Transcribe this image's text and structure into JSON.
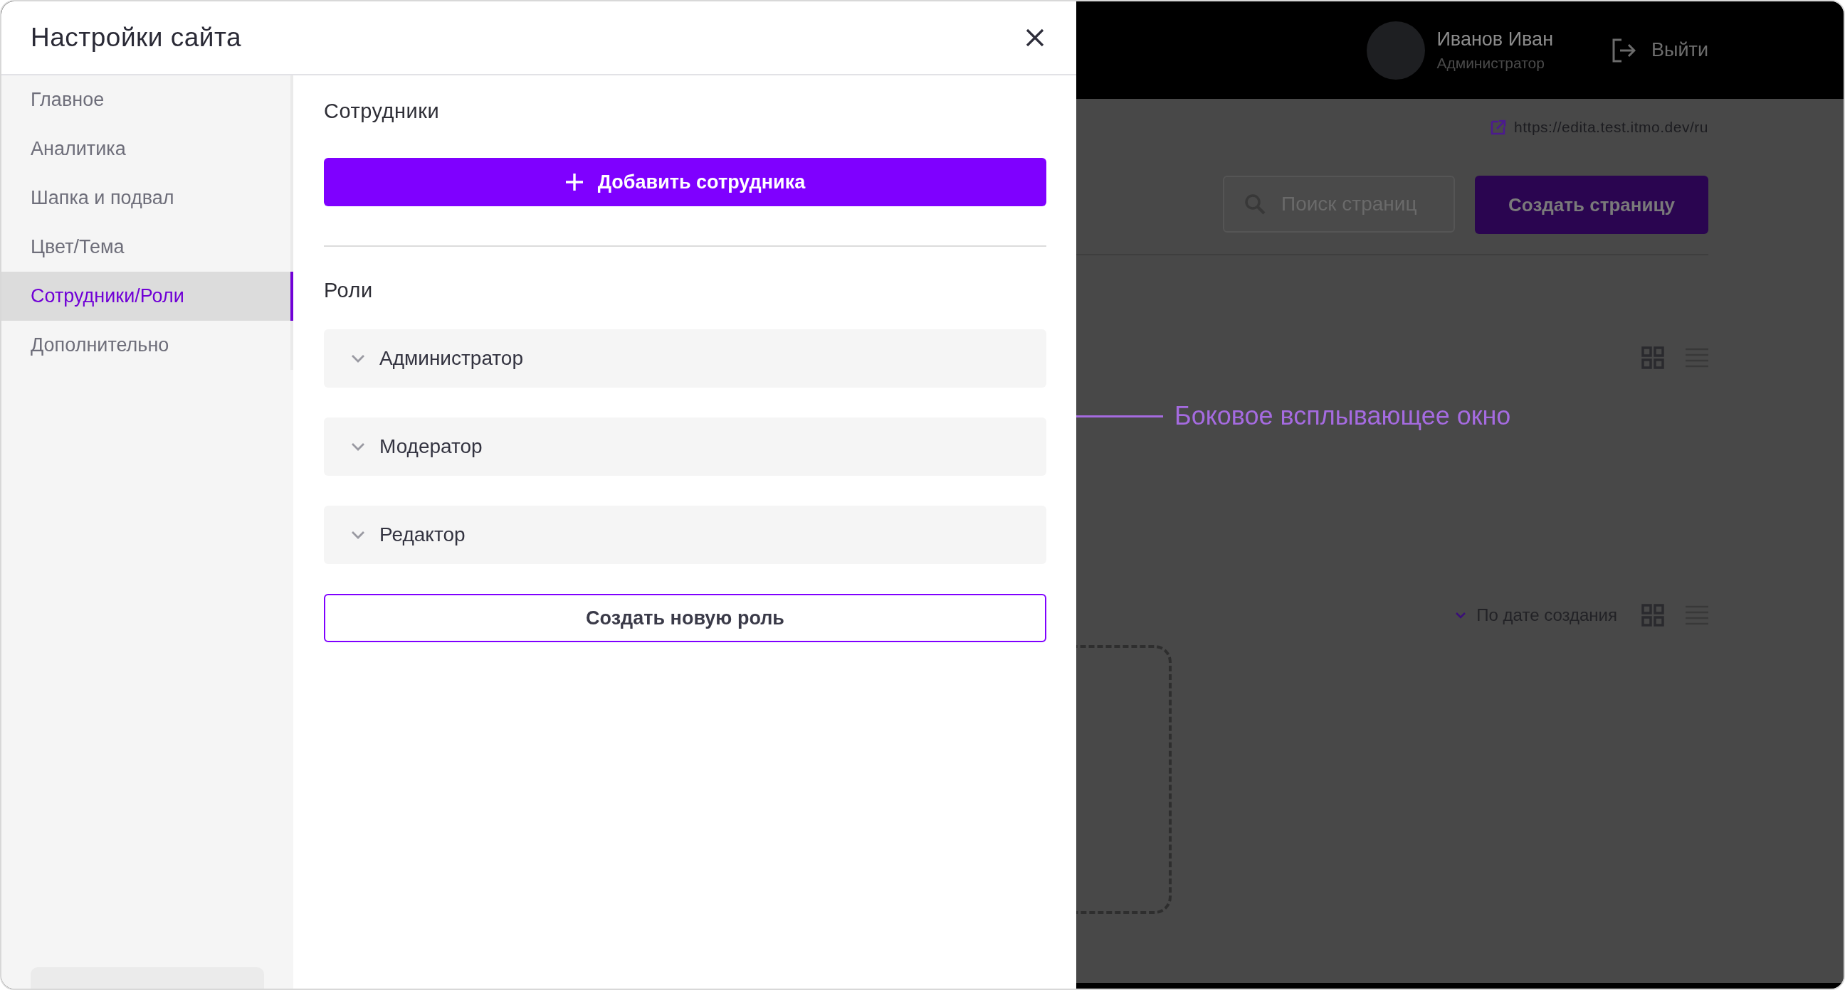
{
  "background_page": {
    "user": {
      "name": "Иванов Иван",
      "role": "Администратор"
    },
    "logout": "Выйти",
    "site_url": "https://edita.test.itmo.dev/ru",
    "search": {
      "placeholder": "Поиск страниц"
    },
    "create_button": "Создать страницу",
    "sort": {
      "label": "По дате создания"
    }
  },
  "annotation": {
    "text": "Боковое всплывающее окно"
  },
  "drawer": {
    "title": "Настройки сайта",
    "sidebar": {
      "items": [
        {
          "label": "Главное",
          "selected": false
        },
        {
          "label": "Аналитика",
          "selected": false
        },
        {
          "label": "Шапка и подвал",
          "selected": false
        },
        {
          "label": "Цвет/Тема",
          "selected": false
        },
        {
          "label": "Сотрудники/Роли",
          "selected": true
        },
        {
          "label": "Дополнительно",
          "selected": false
        }
      ]
    },
    "staff": {
      "title": "Сотрудники",
      "add_button": "Добавить сотрудника"
    },
    "roles": {
      "title": "Роли",
      "items": [
        {
          "label": "Администратор"
        },
        {
          "label": "Модератор"
        },
        {
          "label": "Редактор"
        }
      ],
      "create_button": "Создать новую роль"
    }
  }
}
